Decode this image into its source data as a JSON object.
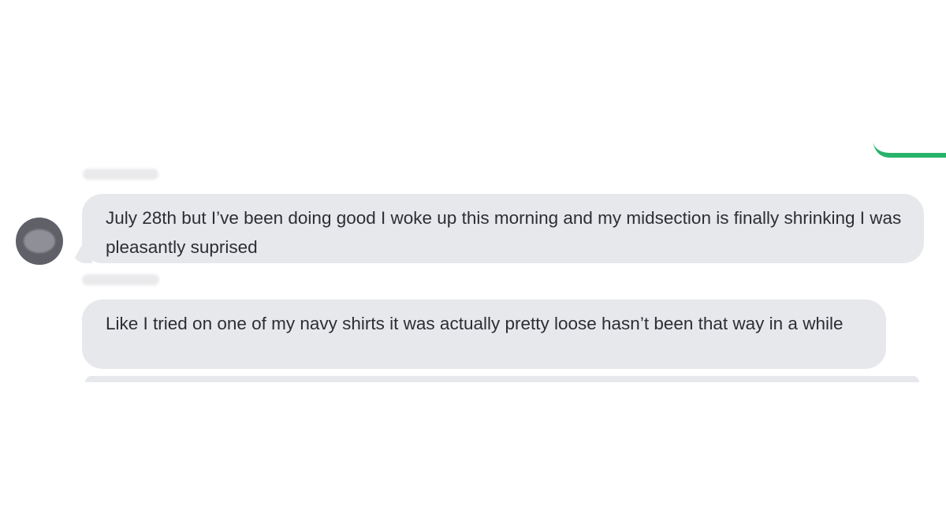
{
  "conversation": {
    "messages": [
      {
        "text": "July 28th but I’ve been doing good I woke up this morning and my midsection is finally shrinking I was pleasantly suprised"
      },
      {
        "text": "Like I tried on one of my navy shirts it was actually pretty loose hasn’t been that way in a while"
      }
    ]
  },
  "colors": {
    "incoming_bubble": "#e7e8ec",
    "message_text": "#2c2e35",
    "avatar": "#5f6068",
    "outgoing_accent": "#27b36a"
  }
}
